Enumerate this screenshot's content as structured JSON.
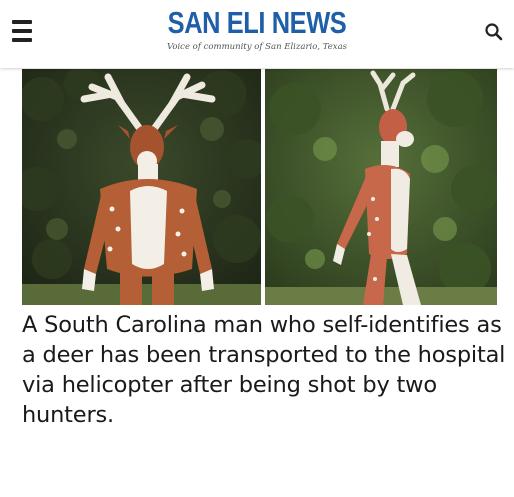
{
  "header": {
    "title_part1": "SAN ELI",
    "title_part2": "NEWS",
    "tagline": "Voice of community of San Elizario, Texas",
    "menu_icon": "hamburger-menu-icon",
    "search_icon": "search-icon",
    "accent_color": "#1f5fa8"
  },
  "article": {
    "headline": "A South Carolina man who self-identifies as a deer has been transported to the hospital via helicopter after being shot by two hunters."
  }
}
